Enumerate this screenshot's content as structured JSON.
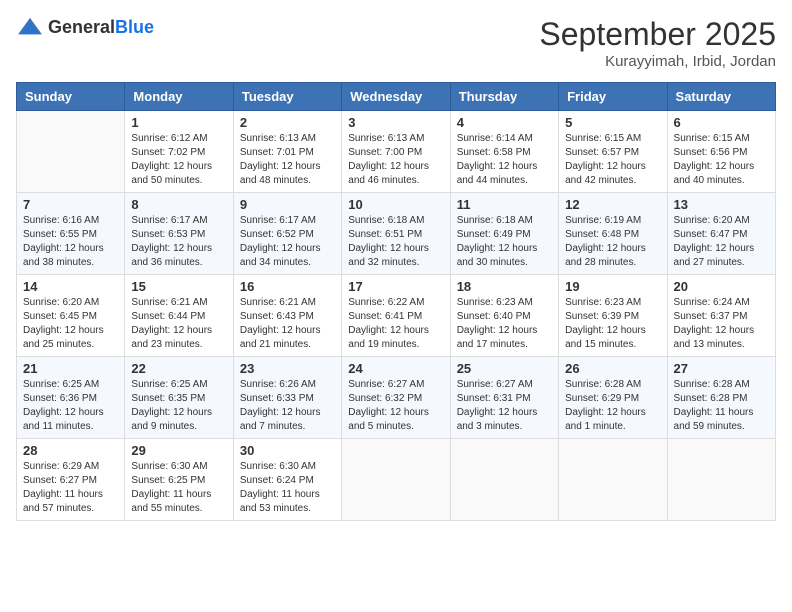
{
  "header": {
    "logo_general": "General",
    "logo_blue": "Blue",
    "month": "September 2025",
    "location": "Kurayyimah, Irbid, Jordan"
  },
  "weekdays": [
    "Sunday",
    "Monday",
    "Tuesday",
    "Wednesday",
    "Thursday",
    "Friday",
    "Saturday"
  ],
  "weeks": [
    [
      {
        "day": "",
        "empty": true
      },
      {
        "day": "1",
        "sunrise": "Sunrise: 6:12 AM",
        "sunset": "Sunset: 7:02 PM",
        "daylight": "Daylight: 12 hours and 50 minutes."
      },
      {
        "day": "2",
        "sunrise": "Sunrise: 6:13 AM",
        "sunset": "Sunset: 7:01 PM",
        "daylight": "Daylight: 12 hours and 48 minutes."
      },
      {
        "day": "3",
        "sunrise": "Sunrise: 6:13 AM",
        "sunset": "Sunset: 7:00 PM",
        "daylight": "Daylight: 12 hours and 46 minutes."
      },
      {
        "day": "4",
        "sunrise": "Sunrise: 6:14 AM",
        "sunset": "Sunset: 6:58 PM",
        "daylight": "Daylight: 12 hours and 44 minutes."
      },
      {
        "day": "5",
        "sunrise": "Sunrise: 6:15 AM",
        "sunset": "Sunset: 6:57 PM",
        "daylight": "Daylight: 12 hours and 42 minutes."
      },
      {
        "day": "6",
        "sunrise": "Sunrise: 6:15 AM",
        "sunset": "Sunset: 6:56 PM",
        "daylight": "Daylight: 12 hours and 40 minutes."
      }
    ],
    [
      {
        "day": "7",
        "sunrise": "Sunrise: 6:16 AM",
        "sunset": "Sunset: 6:55 PM",
        "daylight": "Daylight: 12 hours and 38 minutes."
      },
      {
        "day": "8",
        "sunrise": "Sunrise: 6:17 AM",
        "sunset": "Sunset: 6:53 PM",
        "daylight": "Daylight: 12 hours and 36 minutes."
      },
      {
        "day": "9",
        "sunrise": "Sunrise: 6:17 AM",
        "sunset": "Sunset: 6:52 PM",
        "daylight": "Daylight: 12 hours and 34 minutes."
      },
      {
        "day": "10",
        "sunrise": "Sunrise: 6:18 AM",
        "sunset": "Sunset: 6:51 PM",
        "daylight": "Daylight: 12 hours and 32 minutes."
      },
      {
        "day": "11",
        "sunrise": "Sunrise: 6:18 AM",
        "sunset": "Sunset: 6:49 PM",
        "daylight": "Daylight: 12 hours and 30 minutes."
      },
      {
        "day": "12",
        "sunrise": "Sunrise: 6:19 AM",
        "sunset": "Sunset: 6:48 PM",
        "daylight": "Daylight: 12 hours and 28 minutes."
      },
      {
        "day": "13",
        "sunrise": "Sunrise: 6:20 AM",
        "sunset": "Sunset: 6:47 PM",
        "daylight": "Daylight: 12 hours and 27 minutes."
      }
    ],
    [
      {
        "day": "14",
        "sunrise": "Sunrise: 6:20 AM",
        "sunset": "Sunset: 6:45 PM",
        "daylight": "Daylight: 12 hours and 25 minutes."
      },
      {
        "day": "15",
        "sunrise": "Sunrise: 6:21 AM",
        "sunset": "Sunset: 6:44 PM",
        "daylight": "Daylight: 12 hours and 23 minutes."
      },
      {
        "day": "16",
        "sunrise": "Sunrise: 6:21 AM",
        "sunset": "Sunset: 6:43 PM",
        "daylight": "Daylight: 12 hours and 21 minutes."
      },
      {
        "day": "17",
        "sunrise": "Sunrise: 6:22 AM",
        "sunset": "Sunset: 6:41 PM",
        "daylight": "Daylight: 12 hours and 19 minutes."
      },
      {
        "day": "18",
        "sunrise": "Sunrise: 6:23 AM",
        "sunset": "Sunset: 6:40 PM",
        "daylight": "Daylight: 12 hours and 17 minutes."
      },
      {
        "day": "19",
        "sunrise": "Sunrise: 6:23 AM",
        "sunset": "Sunset: 6:39 PM",
        "daylight": "Daylight: 12 hours and 15 minutes."
      },
      {
        "day": "20",
        "sunrise": "Sunrise: 6:24 AM",
        "sunset": "Sunset: 6:37 PM",
        "daylight": "Daylight: 12 hours and 13 minutes."
      }
    ],
    [
      {
        "day": "21",
        "sunrise": "Sunrise: 6:25 AM",
        "sunset": "Sunset: 6:36 PM",
        "daylight": "Daylight: 12 hours and 11 minutes."
      },
      {
        "day": "22",
        "sunrise": "Sunrise: 6:25 AM",
        "sunset": "Sunset: 6:35 PM",
        "daylight": "Daylight: 12 hours and 9 minutes."
      },
      {
        "day": "23",
        "sunrise": "Sunrise: 6:26 AM",
        "sunset": "Sunset: 6:33 PM",
        "daylight": "Daylight: 12 hours and 7 minutes."
      },
      {
        "day": "24",
        "sunrise": "Sunrise: 6:27 AM",
        "sunset": "Sunset: 6:32 PM",
        "daylight": "Daylight: 12 hours and 5 minutes."
      },
      {
        "day": "25",
        "sunrise": "Sunrise: 6:27 AM",
        "sunset": "Sunset: 6:31 PM",
        "daylight": "Daylight: 12 hours and 3 minutes."
      },
      {
        "day": "26",
        "sunrise": "Sunrise: 6:28 AM",
        "sunset": "Sunset: 6:29 PM",
        "daylight": "Daylight: 12 hours and 1 minute."
      },
      {
        "day": "27",
        "sunrise": "Sunrise: 6:28 AM",
        "sunset": "Sunset: 6:28 PM",
        "daylight": "Daylight: 11 hours and 59 minutes."
      }
    ],
    [
      {
        "day": "28",
        "sunrise": "Sunrise: 6:29 AM",
        "sunset": "Sunset: 6:27 PM",
        "daylight": "Daylight: 11 hours and 57 minutes."
      },
      {
        "day": "29",
        "sunrise": "Sunrise: 6:30 AM",
        "sunset": "Sunset: 6:25 PM",
        "daylight": "Daylight: 11 hours and 55 minutes."
      },
      {
        "day": "30",
        "sunrise": "Sunrise: 6:30 AM",
        "sunset": "Sunset: 6:24 PM",
        "daylight": "Daylight: 11 hours and 53 minutes."
      },
      {
        "day": "",
        "empty": true
      },
      {
        "day": "",
        "empty": true
      },
      {
        "day": "",
        "empty": true
      },
      {
        "day": "",
        "empty": true
      }
    ]
  ]
}
